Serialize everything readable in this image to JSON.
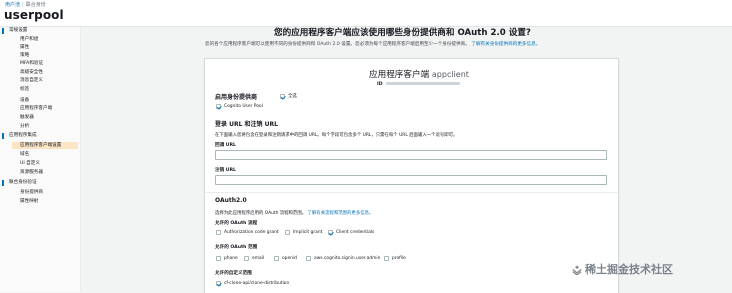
{
  "breadcrumb": {
    "items": [
      "用户池",
      "联合身份"
    ]
  },
  "pool": {
    "name": "userpool"
  },
  "sidebar": {
    "sections": [
      {
        "label": "常规设置",
        "items": [
          "用户和组",
          "属性",
          "策略",
          "MFA和验证",
          "高级安全性",
          "消息自定义",
          "标签",
          "设备",
          "应用程序客户端",
          "触发器",
          "分析"
        ]
      },
      {
        "label": "应用程序集成",
        "items": [
          "应用程序客户端设置",
          "域名",
          "UI 自定义",
          "资源服务器"
        ]
      },
      {
        "label": "联合身份验证",
        "items": [
          "身份提供商",
          "属性映射"
        ]
      }
    ],
    "active_item": "应用程序客户端设置"
  },
  "main": {
    "title": "您的应用程序客户端应该使用哪些身份提供商和 OAuth 2.0 设置?",
    "description": "您的各个应用程序客户端可以使用不同的身份提供商和 OAuth 2.0 设置。您必须为每个应用程序客户端启用至少一个身份提供商。",
    "learn_more": "了解有关身份提供商的更多信息。"
  },
  "client": {
    "title": "应用程序客户端",
    "name": "appclient",
    "id_label": "ID"
  },
  "providers": {
    "heading": "启用身份提供商",
    "select_all": "全选",
    "items": [
      {
        "label": "Cognito User Pool",
        "checked": true
      }
    ]
  },
  "urls": {
    "heading": "登录 URL 和注销 URL",
    "description": "在下面输入您将包含在登录和注销请求中的回调 URL。每个字段可包含多个 URL，只需在每个 URL 后面输入一个逗号即可。",
    "callback_label": "回调 URL",
    "callback_value": "",
    "signout_label": "注销 URL",
    "signout_value": ""
  },
  "oauth": {
    "heading": "OAuth2.0",
    "description": "选择为此应用程序启用的 OAuth 流程和范围。",
    "learn_more": "了解有关流程和范围的更多信息。",
    "flows_label": "允许的 OAuth 流程",
    "flows": [
      {
        "label": "Authorization code grant",
        "checked": false
      },
      {
        "label": "Implicit grant",
        "checked": false
      },
      {
        "label": "Client credentials",
        "checked": true
      }
    ],
    "scopes_label": "允许的 OAuth 范围",
    "scopes": [
      {
        "label": "phone",
        "checked": false
      },
      {
        "label": "email",
        "checked": false
      },
      {
        "label": "openid",
        "checked": false
      },
      {
        "label": "aws.cognito.signin.user.admin",
        "checked": false
      },
      {
        "label": "profile",
        "checked": false
      }
    ],
    "custom_scopes_label": "允许的自定义范围",
    "custom_scopes": [
      {
        "label": "cf-clone-api/clone-distribution",
        "checked": true
      }
    ]
  },
  "watermark": {
    "text": "稀土掘金技术社区"
  },
  "colors": {
    "accent": "#0073bb",
    "active_nav_bg": "#fbe5c4",
    "page_bg": "#f2f3f3"
  }
}
